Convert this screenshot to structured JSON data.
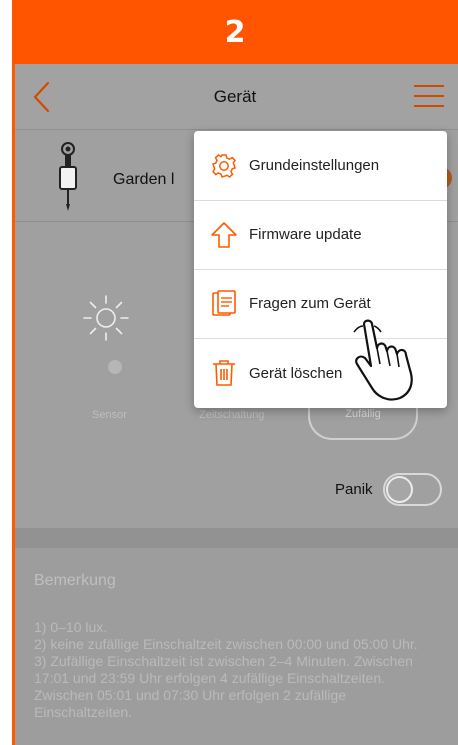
{
  "step": {
    "number": "2",
    "color": "#ff5500"
  },
  "appbar": {
    "title": "Gerät"
  },
  "device": {
    "name": "Garden l",
    "status_color": "#b65a22"
  },
  "modes": {
    "sensor_label": "Sensor",
    "zeitschaltung_label": "Zeitschaltung",
    "zufaellig_label": "Zufällig"
  },
  "panik": {
    "label": "Panik",
    "enabled": false
  },
  "remarks": {
    "title": "Bemerkung",
    "lines": [
      "1) 0–10 lux.",
      "2) keine zufällige Einschaltzeit zwischen 00:00 und 05:00 Uhr.",
      "3) Zufällige Einschaltzeit ist zwischen 2–4 Minuten. Zwischen 17:01 und 23:59 Uhr erfolgen 4 zufällige Einschaltzeiten. Zwischen 05:01 und 07:30 Uhr erfolgen 2 zufällige Einschaltzeiten."
    ]
  },
  "menu": {
    "items": [
      {
        "label": "Grundeinstellungen",
        "icon": "gear-icon"
      },
      {
        "label": "Firmware update",
        "icon": "upload-arrow-icon"
      },
      {
        "label": "Fragen zum Gerät",
        "icon": "document-icon"
      },
      {
        "label": "Gerät löschen",
        "icon": "trash-icon"
      }
    ],
    "accent": "#ff5a00"
  }
}
